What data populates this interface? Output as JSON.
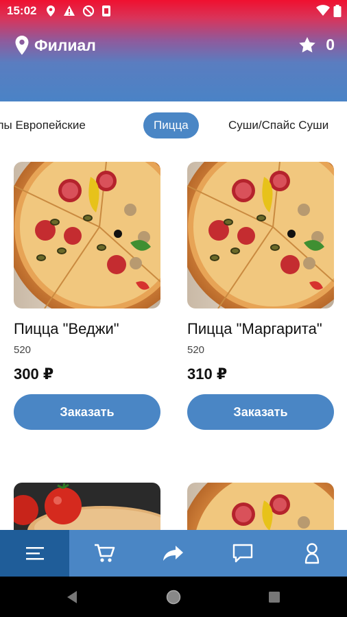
{
  "status_bar": {
    "time": "15:02"
  },
  "header": {
    "branch_label": "Филиал",
    "favorites_count": "0"
  },
  "categories": [
    {
      "label": "Роллы Европейские",
      "active": false
    },
    {
      "label": "Пицца",
      "active": true
    },
    {
      "label": "Суши/Спайс Суши",
      "active": false
    }
  ],
  "products": [
    {
      "name": "Пицца \"Веджи\"",
      "weight": "520",
      "price": "300 ₽",
      "button": "Заказать"
    },
    {
      "name": "Пицца \"Маргарита\"",
      "weight": "520",
      "price": "310 ₽",
      "button": "Заказать"
    }
  ],
  "bottom_nav": [
    {
      "icon": "menu-icon",
      "active": true
    },
    {
      "icon": "cart-icon",
      "active": false
    },
    {
      "icon": "share-icon",
      "active": false
    },
    {
      "icon": "chat-icon",
      "active": false
    },
    {
      "icon": "profile-icon",
      "active": false
    }
  ],
  "colors": {
    "accent": "#4a86c5",
    "accent_dark": "#1f5d99",
    "header_top": "#f0102f"
  }
}
